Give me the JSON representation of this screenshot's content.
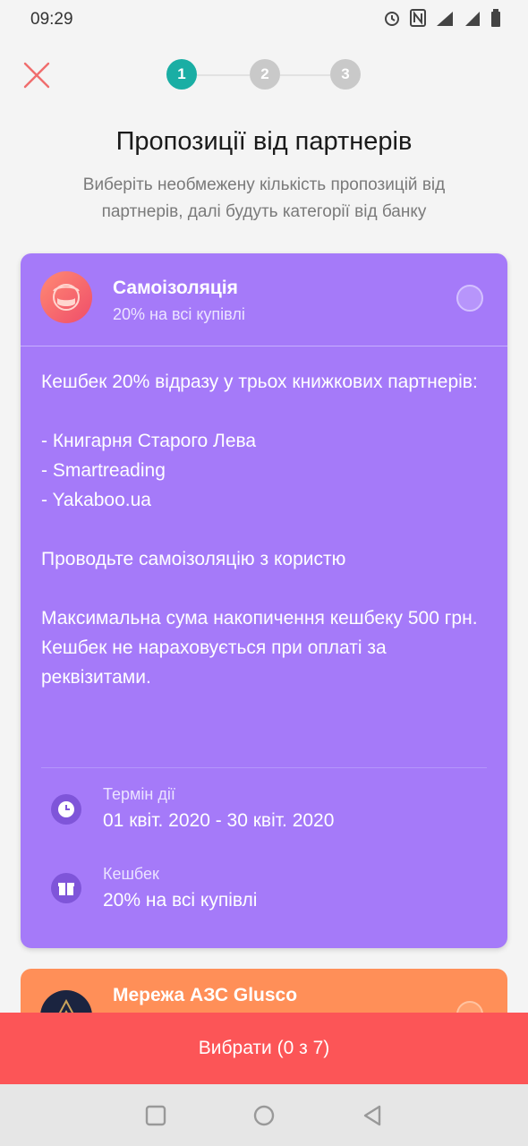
{
  "status_bar": {
    "time": "09:29",
    "icons": [
      "alarm-icon",
      "nfc-icon",
      "data-signal-icon",
      "signal-icon",
      "battery-icon"
    ]
  },
  "header": {
    "close_icon": "close-icon",
    "steps": [
      "1",
      "2",
      "3"
    ],
    "active_step": 1,
    "accent_color": "#1aaea4"
  },
  "title": "Пропозиції від партнерів",
  "subtitle": "Виберіть необмежену кількість пропозицій від партнерів, далі будуть категорії від банку",
  "offer": {
    "name": "Самоізоляція",
    "subtitle": "20% на всі купівлі",
    "card_color": "#a57af9",
    "description": {
      "line1": "Кешбек 20% відразу у трьох книжкових партнерів:",
      "item1": "- Книгарня Старого Лева",
      "item2": "- Smartreading",
      "item3": "- Yakaboo.ua",
      "line2": "Проводьте самоізоляцію з користю",
      "line3": "Максимальна сума накопичення кешбеку 500 грн.",
      "line4": "Кешбек не нараховується при оплаті за реквізитами."
    },
    "term_label": "Термін дії",
    "term_value": "01 квіт. 2020 - 30 квіт. 2020",
    "cashback_label": "Кешбек",
    "cashback_value": "20% на всі купівлі"
  },
  "offer2": {
    "name": "Мережа АЗС Glusco",
    "card_color": "#ff8f58"
  },
  "select_button": "Вибрати (0 з 7)",
  "select_color": "#fc5557"
}
